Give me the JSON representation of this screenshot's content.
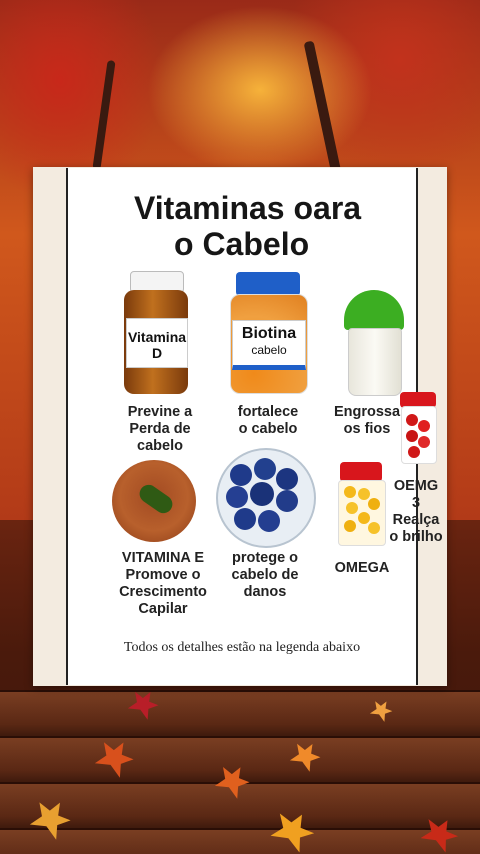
{
  "title_line1": "Vitaminas oara",
  "title_line2": "o Cabelo",
  "items": {
    "vitd": {
      "label_line1": "Vitamina",
      "label_line2": "D",
      "caption": [
        "Previne a",
        "Perda de",
        "cabelo"
      ]
    },
    "biotin": {
      "label_line1": "Biotina",
      "label_line2": "cabelo",
      "caption": [
        "fortalece",
        "o cabelo"
      ]
    },
    "shaker": {
      "caption": [
        "Engrossa",
        "os fios"
      ]
    },
    "vite": {
      "caption": [
        "VITAMINA E",
        "Promove o",
        "Crescimento",
        "Capilar"
      ]
    },
    "berries": {
      "caption": [
        "protege o",
        "cabelo de",
        "danos"
      ]
    },
    "omega": {
      "caption": [
        "OMEGA"
      ]
    },
    "oemg": {
      "caption": [
        "OEMG",
        "3",
        "Realça",
        "o brilho"
      ]
    }
  },
  "footer": "Todos os detalhes estão na legenda abaixo",
  "colors": {
    "lid_red": "#d8161c",
    "lid_blue": "#1f5fc8",
    "lid_green": "#3cae22",
    "amber": "#a45a18",
    "blueberry": "#1f3a8a"
  }
}
